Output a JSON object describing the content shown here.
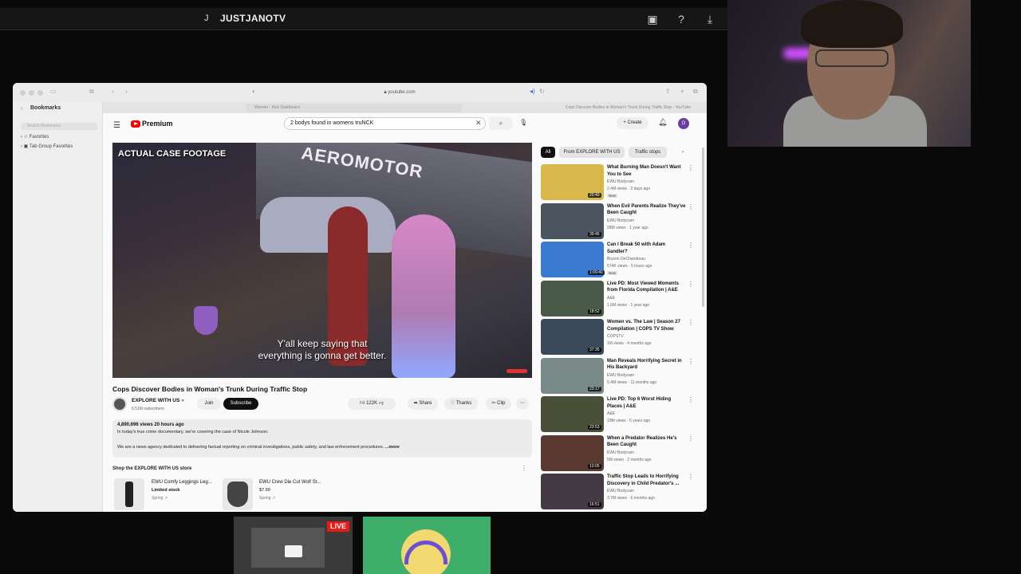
{
  "stream": {
    "initial": "J",
    "username": "JUSTJANOTV",
    "icons": [
      "screen-share-icon",
      "help-icon",
      "download-icon"
    ]
  },
  "browser": {
    "url": "youtube.com",
    "tabs": [
      "Women - Kick Dashboard",
      "Cops Discover Bodies in Woman's Trunk During Traffic Stop - YouTube"
    ]
  },
  "sidebar": {
    "title": "Bookmarks",
    "search_placeholder": "Search Bookmarks",
    "items": [
      "Favorites",
      "Tab Group Favorites"
    ]
  },
  "youtube": {
    "brand": "Premium",
    "search_value": "2 bodys found in womens truNCK",
    "create_label": "Create",
    "avatar_letter": "O",
    "video": {
      "overlay_title": "ACTUAL CASE FOOTAGE",
      "sign_text": "AEROMOTOR",
      "caption_line1": "Y'all keep saying that",
      "caption_line2": "everything is gonna get better."
    },
    "title": "Cops Discover Bodies in Woman's Trunk During Traffic Stop",
    "channel": {
      "name": "EXPLORE WITH US",
      "subscribers": "6.51M subscribers",
      "join": "Join",
      "subscribe": "Subscribe"
    },
    "actions": {
      "likes": "122K",
      "share": "Share",
      "thanks": "Thanks",
      "clip": "Clip"
    },
    "description": {
      "meta": "4,890,696 views  20 hours ago",
      "line1": "In today's true crime documentary, we're covering the case of Nicole Johnson.",
      "line2": "We are a news agency dedicated to delivering factual reporting on criminal investigations, public safety, and law enforcement procedures.",
      "more": "...more"
    },
    "shop": {
      "heading": "Shop the EXPLORE WITH US store",
      "products": [
        {
          "name": "EWU Comfy Leggings Leg...",
          "sub": "Limited stock",
          "src": "Spring"
        },
        {
          "name": "EWU Crew Die Cut Wolf St...",
          "sub": "$7.99",
          "src": "Spring"
        }
      ]
    },
    "chips": [
      "All",
      "From EXPLORE WITH US",
      "Traffic stops"
    ],
    "recommendations": [
      {
        "title": "What Burning Man Doesn't Want You to See",
        "channel": "EWU Bodycam",
        "views": "2.4M views · 2 days ago",
        "duration": "20:40",
        "tag": "New",
        "color": "#d8b84a"
      },
      {
        "title": "When Evil Parents Realize They've Been Caught",
        "channel": "EWU Bodycam",
        "views": "28M views · 1 year ago",
        "duration": "39:45",
        "tag": "",
        "color": "#4a5560"
      },
      {
        "title": "Can I Break 50 with Adam Sandler?",
        "channel": "Bryson DeChambeau",
        "views": "674K views · 5 hours ago",
        "duration": "1:09:40",
        "tag": "New",
        "color": "#3a7ad0"
      },
      {
        "title": "Live PD: Most Viewed Moments from Florida Compilation | A&E",
        "channel": "A&E",
        "views": "1.6M views · 1 year ago",
        "duration": "18:52",
        "tag": "",
        "color": "#4a5a48"
      },
      {
        "title": "Women vs. The Law | Season 27 Compilation | COPS TV Show",
        "channel": "COPSTV",
        "views": "1M views · 4 months ago",
        "duration": "37:35",
        "tag": "",
        "color": "#3a4a58"
      },
      {
        "title": "Man Reveals Horrifying Secret in His Backyard",
        "channel": "EWU Bodycam",
        "views": "5.4M views · 11 months ago",
        "duration": "23:17",
        "tag": "",
        "color": "#7a8a88"
      },
      {
        "title": "Live PD: Top 6 Worst Hiding Places | A&E",
        "channel": "A&E",
        "views": "19M views · 5 years ago",
        "duration": "23:53",
        "tag": "",
        "color": "#4a5038"
      },
      {
        "title": "When a Predator Realizes He's Been Caught",
        "channel": "EWU Bodycam",
        "views": "5M views · 2 months ago",
        "duration": "13:05",
        "tag": "",
        "color": "#5a3a30"
      },
      {
        "title": "Traffic Stop Leads to Horrifying Discovery in Child Predator's ...",
        "channel": "EWU Bodycam",
        "views": "3.7M views · 6 months ago",
        "duration": "16:51",
        "tag": "",
        "color": "#443a44"
      }
    ]
  },
  "bottom": {
    "live_label": "LIVE"
  }
}
